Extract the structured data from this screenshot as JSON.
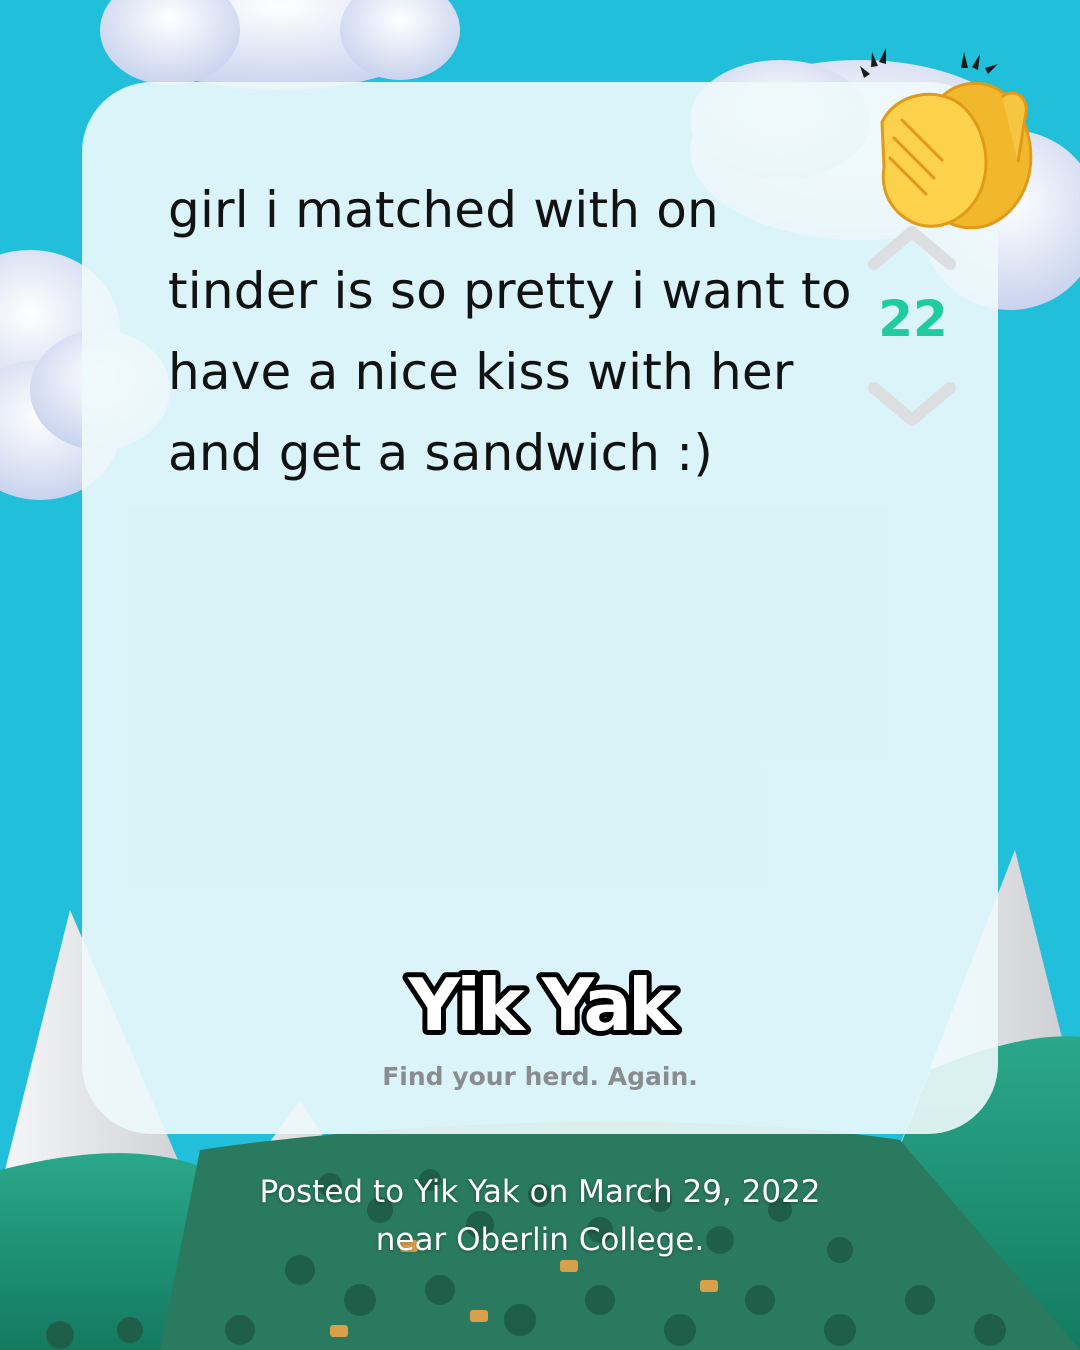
{
  "post": {
    "text": "girl i matched with on tinder is so pretty i want to have a nice kiss with her and get a sandwich :)",
    "vote_count": "22"
  },
  "brand": {
    "logo_text": "Yik Yak",
    "tagline": "Find your herd. Again."
  },
  "footer": {
    "line1": "Posted to Yik Yak on March 29, 2022",
    "line2": "near Oberlin College."
  },
  "icons": {
    "upvote": "chevron-up-icon",
    "downvote": "chevron-down-icon",
    "reaction": "clapping-hands-emoji"
  },
  "colors": {
    "background": "#22bfda",
    "card": "#eef9fc",
    "vote_count": "#1fcc9c",
    "post_text": "#121212",
    "tagline": "#8a8d90"
  }
}
